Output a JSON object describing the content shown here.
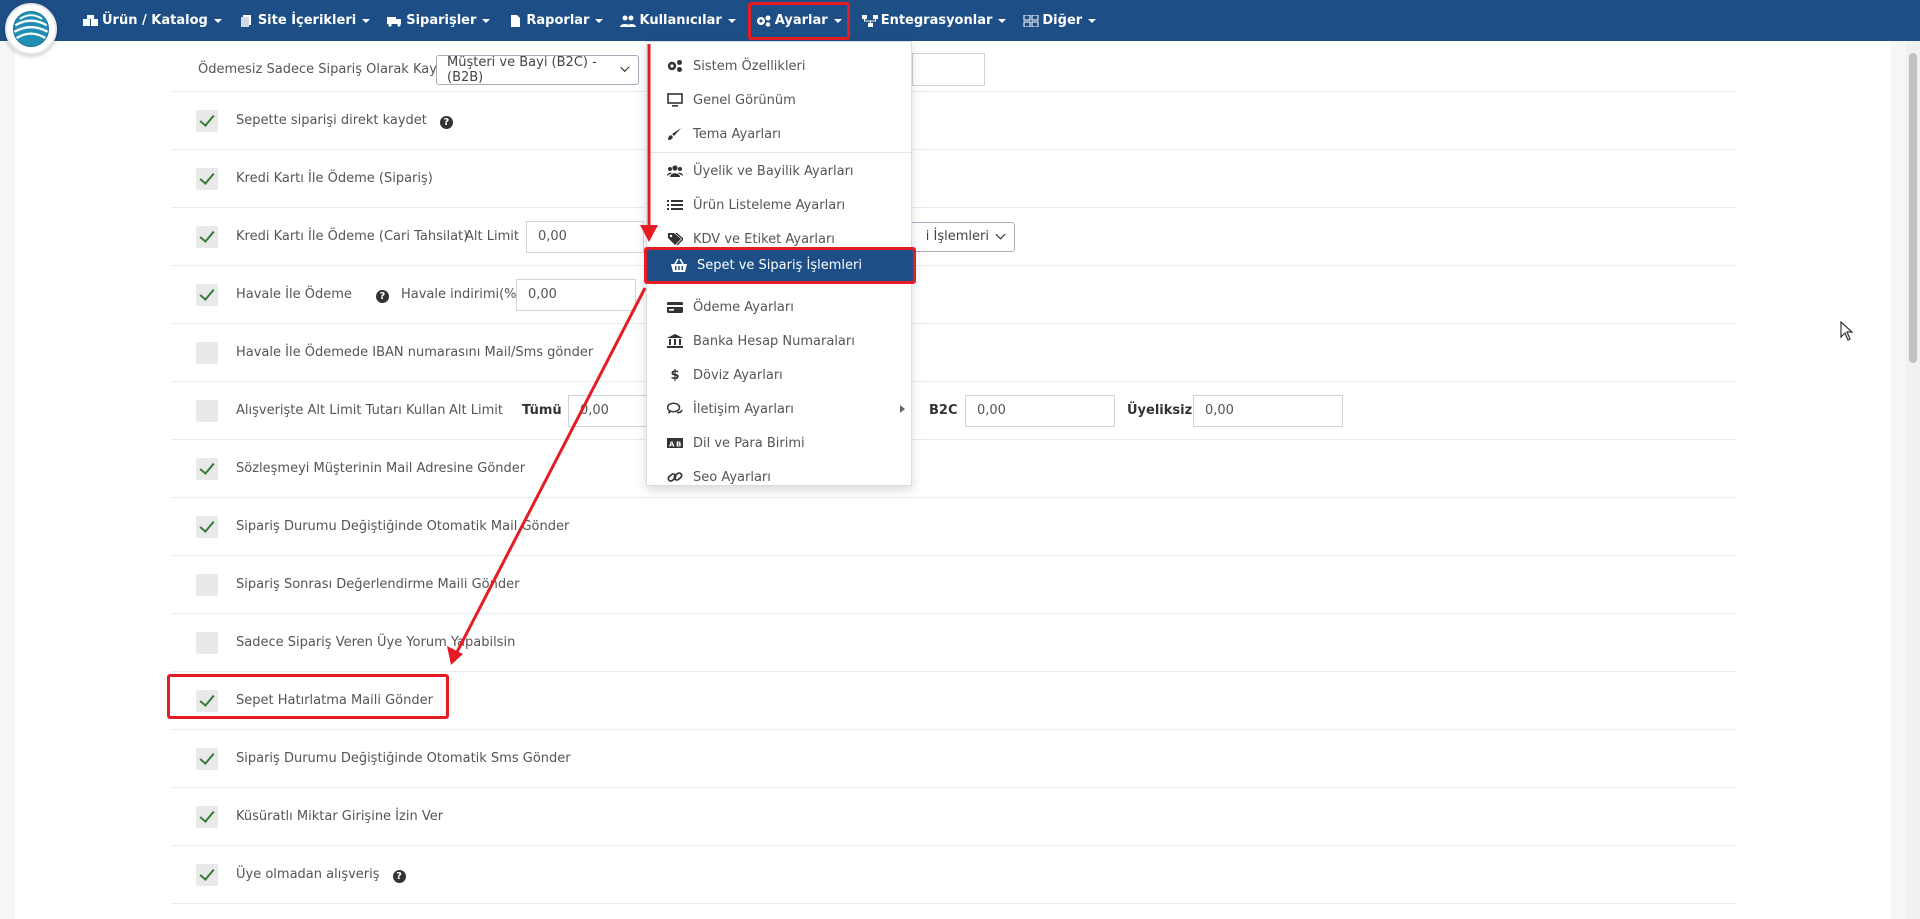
{
  "navbar": {
    "items": [
      {
        "label": "Ürün / Katalog",
        "icon": "boxes-icon"
      },
      {
        "label": "Site İçerikleri",
        "icon": "copy-icon"
      },
      {
        "label": "Siparişler",
        "icon": "truck-icon"
      },
      {
        "label": "Raporlar",
        "icon": "file-icon"
      },
      {
        "label": "Kullanıcılar",
        "icon": "users-icon"
      },
      {
        "label": "Ayarlar",
        "icon": "cogs-icon"
      },
      {
        "label": "Entegrasyonlar",
        "icon": "network-icon"
      },
      {
        "label": "Diğer",
        "icon": "grid-icon"
      }
    ],
    "highlighted": "Ayarlar",
    "bg_color": "#1d4f86"
  },
  "settings_menu": {
    "items": [
      {
        "label": "Sistem Özellikleri",
        "icon": "cogs-icon"
      },
      {
        "label": "Genel Görünüm",
        "icon": "monitor-icon"
      },
      {
        "label": "Tema Ayarları",
        "icon": "brush-icon"
      },
      {
        "label": "Üyelik ve Bayilik Ayarları",
        "icon": "users-icon"
      },
      {
        "label": "Ürün Listeleme Ayarları",
        "icon": "list-icon"
      },
      {
        "label": "KDV ve Etiket Ayarları",
        "icon": "tags-icon"
      },
      {
        "label": "Sepet ve Sipariş İşlemleri",
        "icon": "basket-icon"
      },
      {
        "label": "Ödeme Ayarları",
        "icon": "credit-card-icon"
      },
      {
        "label": "Banka Hesap Numaraları",
        "icon": "bank-icon"
      },
      {
        "label": "Döviz Ayarları",
        "icon": "dollar-icon"
      },
      {
        "label": "İletişim Ayarları",
        "icon": "comments-icon"
      },
      {
        "label": "Dil ve Para Birimi",
        "icon": "language-icon"
      },
      {
        "label": "Seo Ayarları",
        "icon": "link-icon"
      }
    ],
    "active": "Sepet ve Sipariş İşlemleri"
  },
  "form": {
    "first_row": {
      "label": "Ödemesiz Sadece Sipariş Olarak Kayıt",
      "select_value": "Müşteri ve Bayi (B2C) - (B2B)"
    },
    "rows": [
      {
        "label": "Sepette siparişi direkt kaydet",
        "checked": true,
        "help": "?"
      },
      {
        "label": "Kredi Kartı İle Ödeme (Sipariş)",
        "checked": true
      },
      {
        "label": "Kredi Kartı İle Ödeme (Cari Tahsilat)",
        "checked": true,
        "alt_limit_label": "Alt Limit",
        "alt_limit_value": "0,00",
        "select_suffix": "i İşlemleri"
      },
      {
        "label": "Havale İle Ödeme",
        "checked": true,
        "help": "?",
        "discount_label": "Havale indirimi(%)",
        "discount_value": "0,00"
      },
      {
        "label": "Havale İle Ödemede IBAN numarasını Mail/Sms gönder",
        "checked": false
      },
      {
        "label": "Alışverişte Alt Limit Tutarı Kullan",
        "checked": false,
        "alt_limit_label": "Alt Limit",
        "all_label": "Tümü",
        "all_value": "0,00",
        "b2c_label": "B2C",
        "b2c_value": "0,00",
        "nonmember_label": "Üyeliksiz",
        "nonmember_value": "0,00"
      },
      {
        "label": "Sözleşmeyi Müşterinin Mail Adresine Gönder",
        "checked": true
      },
      {
        "label": "Sipariş Durumu Değiştiğinde Otomatik Mail Gönder",
        "checked": true
      },
      {
        "label": "Sipariş Sonrası Değerlendirme Maili Gönder",
        "checked": false
      },
      {
        "label": "Sadece Sipariş Veren Üye Yorum Yapabilsin",
        "checked": false
      },
      {
        "label": "Sepet Hatırlatma Maili Gönder",
        "checked": true
      },
      {
        "label": "Sipariş Durumu Değiştiğinde Otomatik Sms Gönder",
        "checked": true
      },
      {
        "label": "Küsüratlı Miktar Girişine İzin Ver",
        "checked": true
      },
      {
        "label": "Üye olmadan alışveriş",
        "checked": true,
        "help": "?"
      }
    ]
  },
  "annotation_color": "#e51c23"
}
